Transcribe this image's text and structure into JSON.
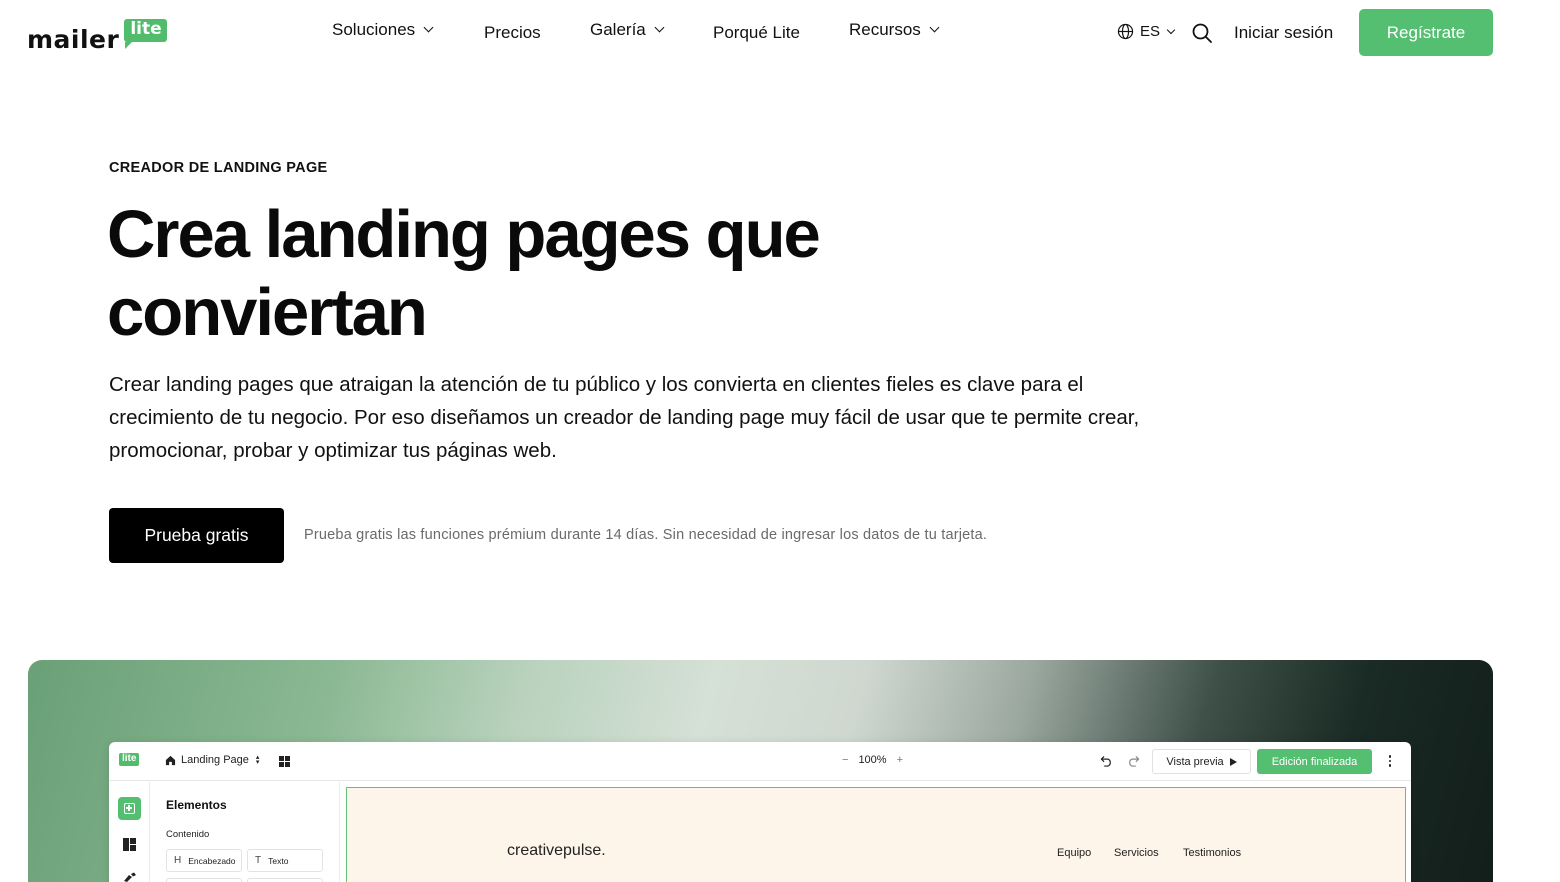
{
  "header": {
    "logo": {
      "wordmark": "mailer",
      "badge": "lite"
    },
    "nav": [
      {
        "label": "Soluciones",
        "has_dropdown": true
      },
      {
        "label": "Precios",
        "has_dropdown": false
      },
      {
        "label": "Galería",
        "has_dropdown": true
      },
      {
        "label": "Porqué Lite",
        "has_dropdown": false
      },
      {
        "label": "Recursos",
        "has_dropdown": true
      }
    ],
    "language": "ES",
    "login_label": "Iniciar sesión",
    "signup_label": "Regístrate"
  },
  "hero": {
    "eyebrow": "CREADOR DE LANDING PAGE",
    "title_line1": "Crea landing pages que",
    "title_line2": "conviertan",
    "description": "Crear landing pages que atraigan la atención de tu público y los convierta en clientes fieles es clave para el crecimiento de tu negocio. Por eso diseñamos un creador de landing page muy fácil de usar que te permite crear, promocionar, probar y optimizar tus páginas web.",
    "cta_label": "Prueba gratis",
    "cta_note": "Prueba gratis las funciones prémium durante 14 días. Sin necesidad de ingresar los datos de tu tarjeta."
  },
  "editor": {
    "logo_badge": "lite",
    "page_selector": "Landing Page",
    "zoom": {
      "minus": "−",
      "value": "100%",
      "plus": "+"
    },
    "preview_label": "Vista previa",
    "done_label": "Edición finalizada",
    "panel": {
      "title": "Elementos",
      "section": "Contenido",
      "items": [
        {
          "icon": "H",
          "label": "Encabezado"
        },
        {
          "icon": "T",
          "label": "Texto"
        },
        {
          "icon": "",
          "label": ""
        },
        {
          "icon": "",
          "label": ""
        }
      ]
    },
    "canvas": {
      "brand": "creativepulse.",
      "nav": [
        "Equipo",
        "Servicios",
        "Testimonios"
      ]
    }
  },
  "colors": {
    "brand_green": "#54bf70",
    "cta_black": "#000000",
    "canvas_bg": "#fdf4ea"
  }
}
